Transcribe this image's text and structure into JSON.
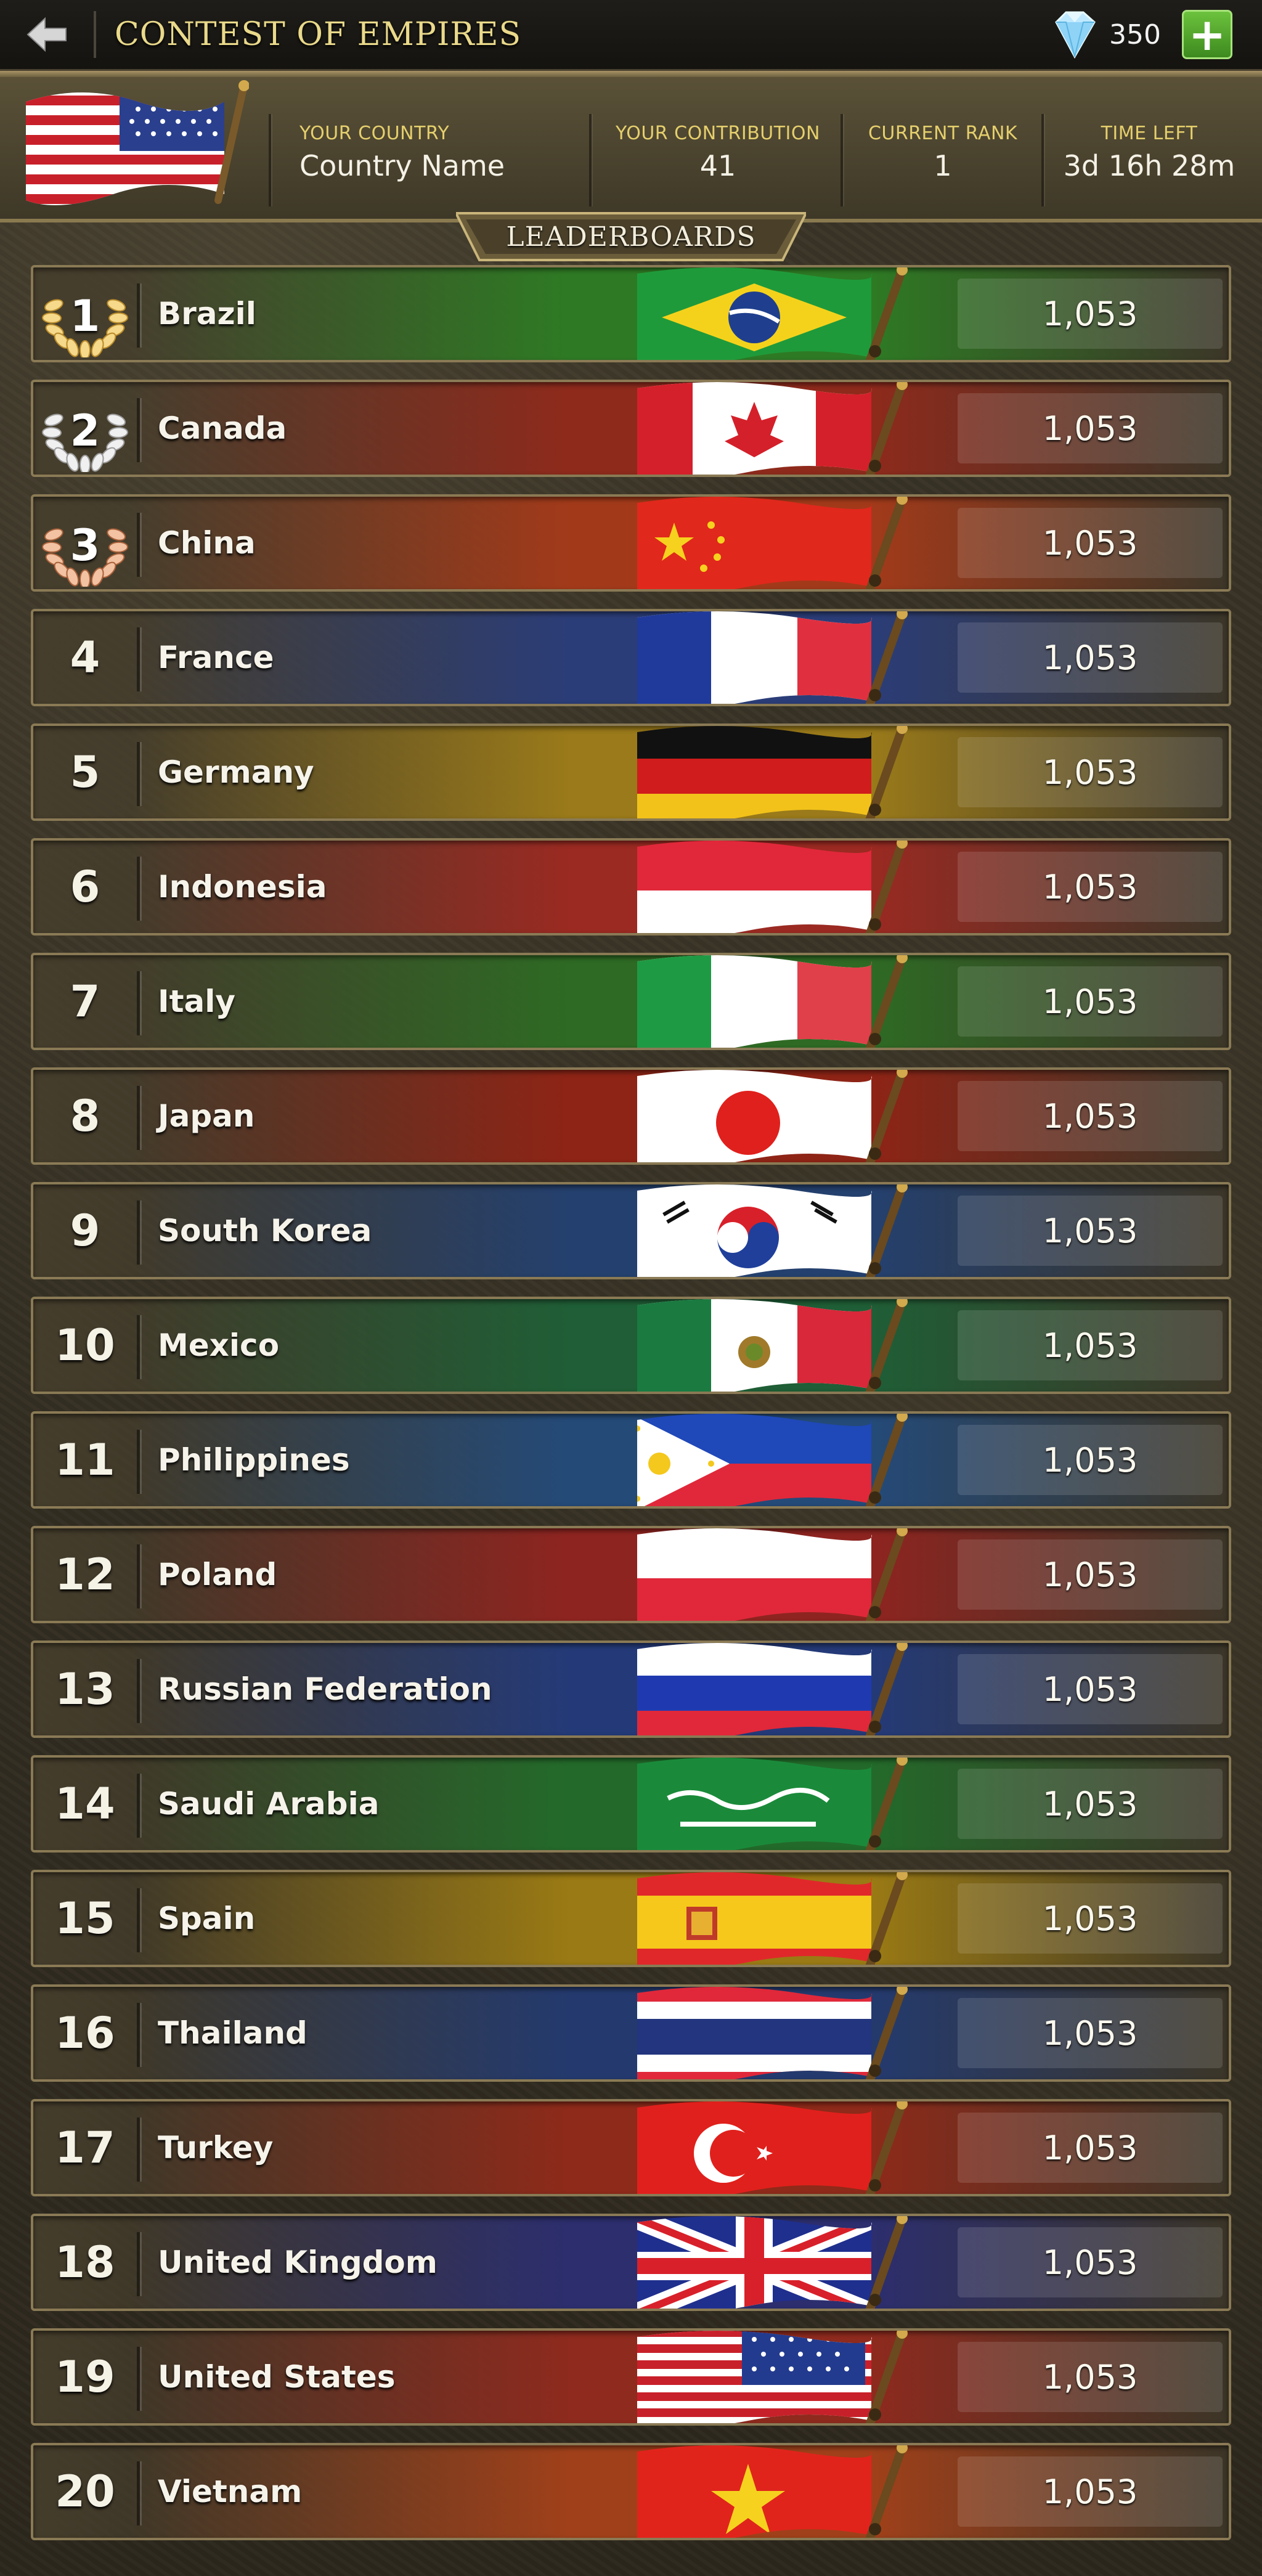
{
  "topbar": {
    "title": "CONTEST OF EMPIRES",
    "gems": "350",
    "back_icon": "back-arrow-icon",
    "gem_icon": "diamond-icon",
    "plus_label": "+"
  },
  "info": {
    "your_country_label": "YOUR COUNTRY",
    "your_country_value": "Country Name",
    "contribution_label": "YOUR CONTRIBUTION",
    "contribution_value": "41",
    "rank_label": "CURRENT RANK",
    "rank_value": "1",
    "time_label": "TIME LEFT",
    "time_value": "3d 16h 28m"
  },
  "leaderboard_title": "LEADERBOARDS",
  "rows": [
    {
      "rank": "1",
      "country": "Brazil",
      "score": "1,053",
      "color": "#2e7a24",
      "flag": "brazil"
    },
    {
      "rank": "2",
      "country": "Canada",
      "score": "1,053",
      "color": "#8e2a1c",
      "flag": "canada"
    },
    {
      "rank": "3",
      "country": "China",
      "score": "1,053",
      "color": "#a23a1a",
      "flag": "china"
    },
    {
      "rank": "4",
      "country": "France",
      "score": "1,053",
      "color": "#2b3d78",
      "flag": "france"
    },
    {
      "rank": "5",
      "country": "Germany",
      "score": "1,053",
      "color": "#9a7a1a",
      "flag": "germany"
    },
    {
      "rank": "6",
      "country": "Indonesia",
      "score": "1,053",
      "color": "#9a2a22",
      "flag": "indonesia"
    },
    {
      "rank": "7",
      "country": "Italy",
      "score": "1,053",
      "color": "#2e6a24",
      "flag": "italy"
    },
    {
      "rank": "8",
      "country": "Japan",
      "score": "1,053",
      "color": "#8e2416",
      "flag": "japan"
    },
    {
      "rank": "9",
      "country": "South Korea",
      "score": "1,053",
      "color": "#24406e",
      "flag": "south-korea"
    },
    {
      "rank": "10",
      "country": "Mexico",
      "score": "1,053",
      "color": "#1f5e36",
      "flag": "mexico"
    },
    {
      "rank": "11",
      "country": "Philippines",
      "score": "1,053",
      "color": "#244a78",
      "flag": "philippines"
    },
    {
      "rank": "12",
      "country": "Poland",
      "score": "1,053",
      "color": "#8e2420",
      "flag": "poland"
    },
    {
      "rank": "13",
      "country": "Russian Federation",
      "score": "1,053",
      "color": "#243a78",
      "flag": "russia"
    },
    {
      "rank": "14",
      "country": "Saudi Arabia",
      "score": "1,053",
      "color": "#236a2a",
      "flag": "saudi-arabia"
    },
    {
      "rank": "15",
      "country": "Spain",
      "score": "1,053",
      "color": "#9a7a14",
      "flag": "spain"
    },
    {
      "rank": "16",
      "country": "Thailand",
      "score": "1,053",
      "color": "#243a6e",
      "flag": "thailand"
    },
    {
      "rank": "17",
      "country": "Turkey",
      "score": "1,053",
      "color": "#8e2a1a",
      "flag": "turkey"
    },
    {
      "rank": "18",
      "country": "United Kingdom",
      "score": "1,053",
      "color": "#2c2e6e",
      "flag": "united-kingdom"
    },
    {
      "rank": "19",
      "country": "United States",
      "score": "1,053",
      "color": "#8e2a1e",
      "flag": "united-states"
    },
    {
      "rank": "20",
      "country": "Vietnam",
      "score": "1,053",
      "color": "#a0401a",
      "flag": "vietnam"
    }
  ]
}
